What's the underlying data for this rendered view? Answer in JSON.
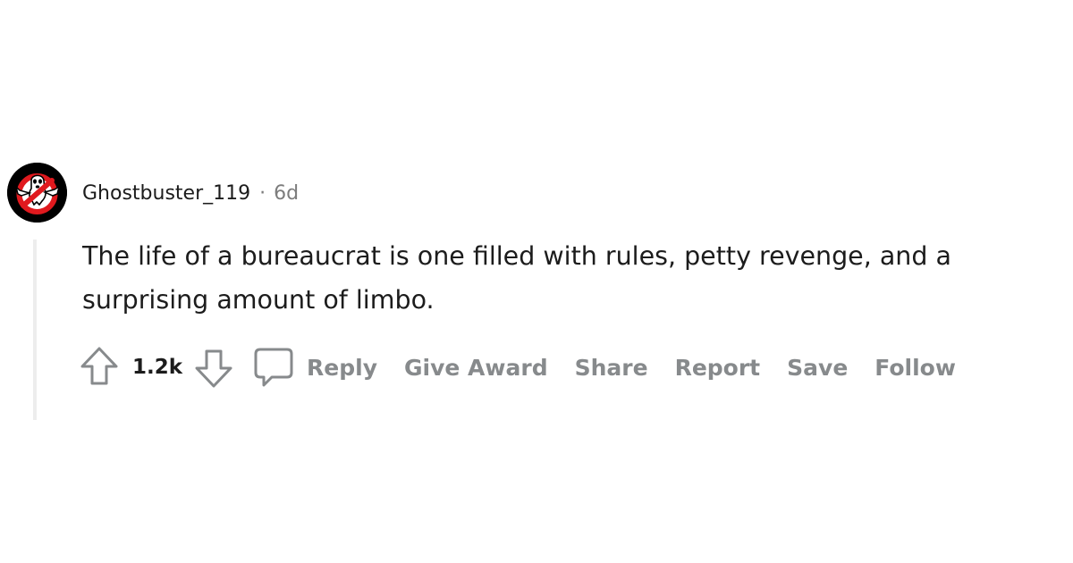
{
  "comment": {
    "author": "Ghostbuster_119",
    "separator": "·",
    "age": "6d",
    "body": "The life of a bureaucrat is one filled with rules, petty revenge, and a surprising amount of limbo.",
    "avatar_icon": "ghostbusters-logo-icon"
  },
  "actions": {
    "score": "1.2k",
    "reply_label": "Reply",
    "give_award_label": "Give Award",
    "share_label": "Share",
    "report_label": "Report",
    "save_label": "Save",
    "follow_label": "Follow"
  },
  "colors": {
    "text": "#1c1c1c",
    "muted": "#7c7c7c",
    "action": "#878a8c",
    "thread_line": "#ededed",
    "logo_red": "#e0191e"
  }
}
